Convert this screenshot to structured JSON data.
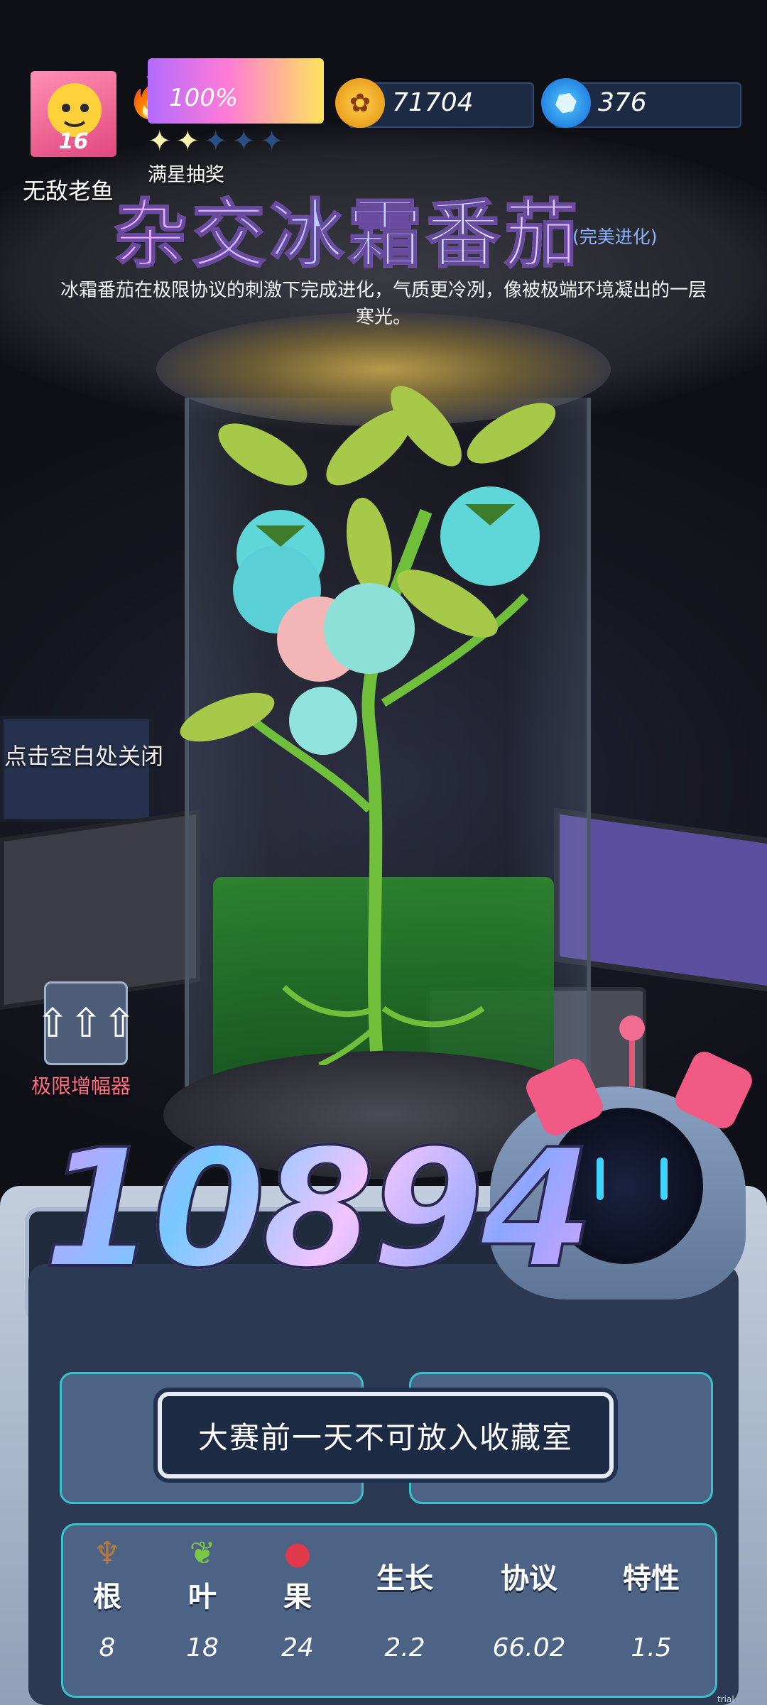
{
  "player": {
    "name": "无敌老鱼",
    "level": "16"
  },
  "energy": {
    "percent_text": "100%",
    "fill": 1.0,
    "stars_filled": 2,
    "stars_total": 5,
    "lottery_label": "满星抽奖"
  },
  "currency": {
    "coins": "71704",
    "gems": "376"
  },
  "plant": {
    "name": "杂交冰霜番茄",
    "evolution": "(完美进化)",
    "description": "冰霜番茄在极限协议的刺激下完成进化，气质更冷冽，像被极端环境凝出的一层寒光。"
  },
  "hint": {
    "close": "点击空白处关闭"
  },
  "amplifier": {
    "label": "极限增幅器"
  },
  "score": "10894",
  "toast": "大赛前一天不可放入收藏室",
  "stats": {
    "columns": [
      {
        "label": "根",
        "value": "8",
        "icon": "root-icon"
      },
      {
        "label": "叶",
        "value": "18",
        "icon": "leaf-icon"
      },
      {
        "label": "果",
        "value": "24",
        "icon": "apple-icon"
      },
      {
        "label": "生长",
        "value": "2.2"
      },
      {
        "label": "协议",
        "value": "66.02"
      },
      {
        "label": "特性",
        "value": "1.5"
      }
    ]
  },
  "watermark": "trial version",
  "colors": {
    "accent": "#38c1c9",
    "panel": "#4d6386",
    "toast_bg": "#1c2a44",
    "amplifier_label": "#ff6f86"
  }
}
